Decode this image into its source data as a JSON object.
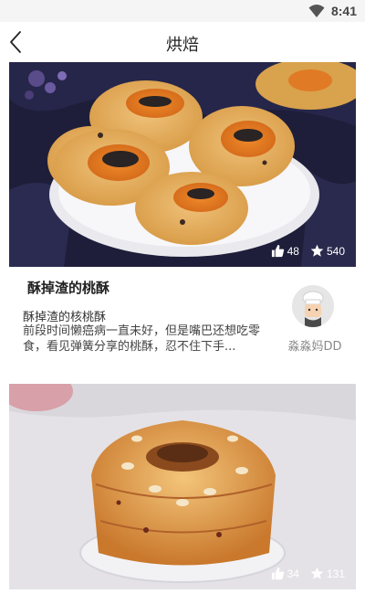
{
  "status_bar": {
    "time": "8:41",
    "icons": [
      "wifi-icon"
    ]
  },
  "header": {
    "title": "烘焙",
    "back_icon": "chevron-left-icon"
  },
  "feed": [
    {
      "title": "酥掉渣的桃酥",
      "subtitle": "酥掉渣的核桃酥",
      "description": "前段时间懒癌病一直未好，但是嘴巴还想吃零食，看见弹簧分享的桃酥，忍不住下手...",
      "author": "淼淼妈DD",
      "likes": "48",
      "favorites": "540"
    },
    {
      "likes": "34",
      "favorites": "131"
    }
  ],
  "colors": {
    "background": "#ffffff",
    "status_bar": "#f5f5f5",
    "author_text": "#888888",
    "cookie": "#e4a855",
    "jam": "#e27d24"
  }
}
